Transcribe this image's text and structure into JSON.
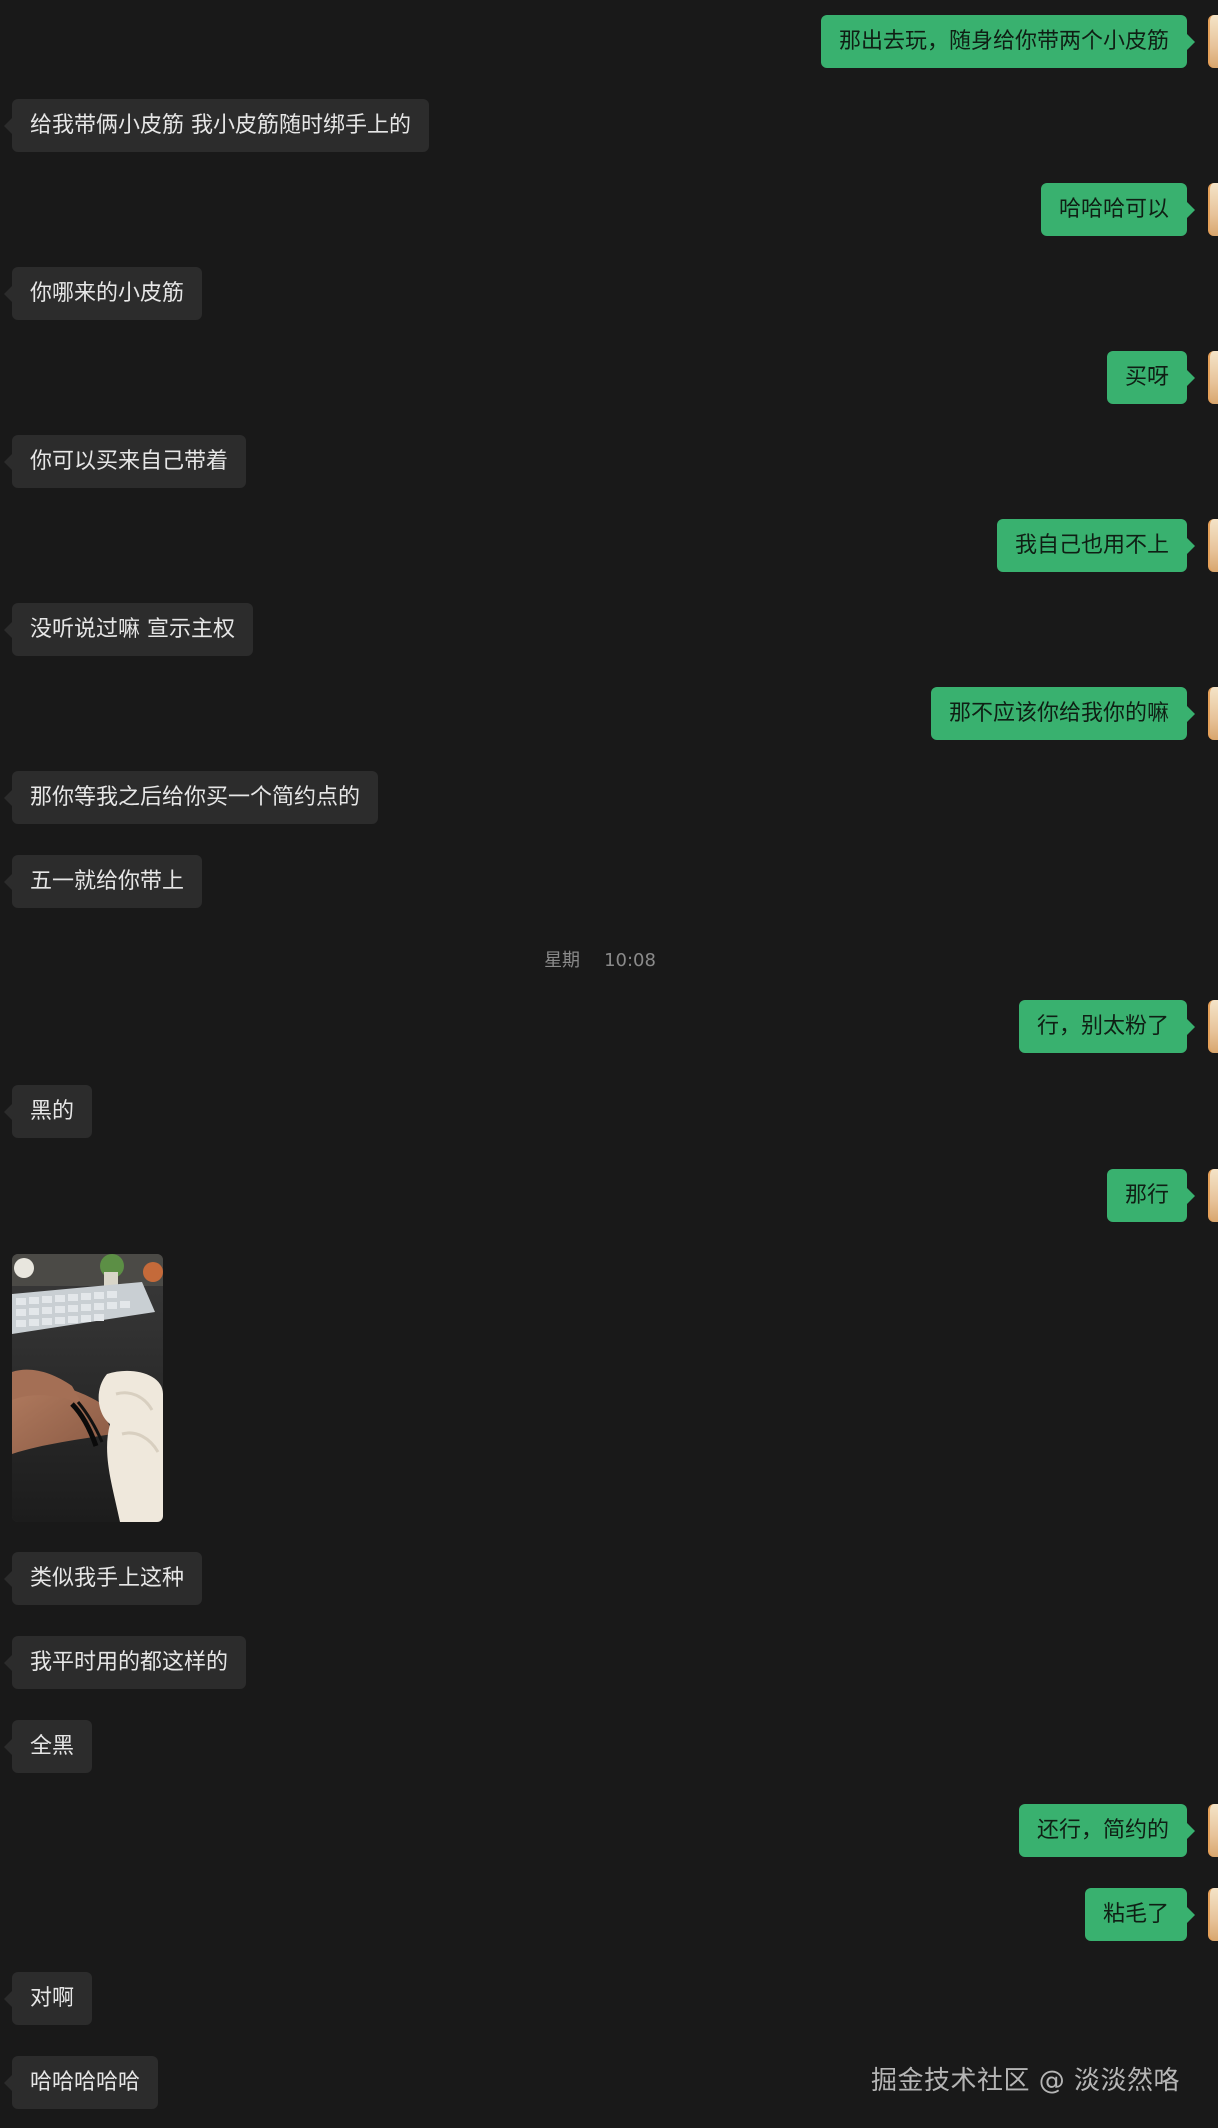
{
  "messages": [
    {
      "side": "out",
      "text": "那出去玩，随身给你带两个小皮筋"
    },
    {
      "side": "in",
      "text": "给我带俩小皮筋 我小皮筋随时绑手上的"
    },
    {
      "side": "out",
      "text": "哈哈哈可以"
    },
    {
      "side": "in",
      "text": "你哪来的小皮筋"
    },
    {
      "side": "out",
      "text": "买呀"
    },
    {
      "side": "in",
      "text": "你可以买来自己带着"
    },
    {
      "side": "out",
      "text": "我自己也用不上"
    },
    {
      "side": "in",
      "text": "没听说过嘛 宣示主权"
    },
    {
      "side": "out",
      "text": "那不应该你给我你的嘛"
    },
    {
      "side": "in",
      "text": "那你等我之后给你买一个简约点的"
    },
    {
      "side": "in",
      "text": "五一就给你带上"
    },
    {
      "side": "out",
      "text": "行，别太粉了"
    },
    {
      "side": "in",
      "text": "黑的"
    },
    {
      "side": "out",
      "text": "那行"
    },
    {
      "side": "in",
      "text": "类似我手上这种"
    },
    {
      "side": "in",
      "text": "我平时用的都这样的"
    },
    {
      "side": "in",
      "text": "全黑"
    },
    {
      "side": "out",
      "text": "还行，简约的"
    },
    {
      "side": "out",
      "text": "粘毛了"
    },
    {
      "side": "in",
      "text": "对啊"
    },
    {
      "side": "in",
      "text": "哈哈哈哈哈"
    }
  ],
  "timestamp": {
    "day": "星期",
    "time": "10:08"
  },
  "watermark": "掘金技术社区 @ 淡淡然咯"
}
